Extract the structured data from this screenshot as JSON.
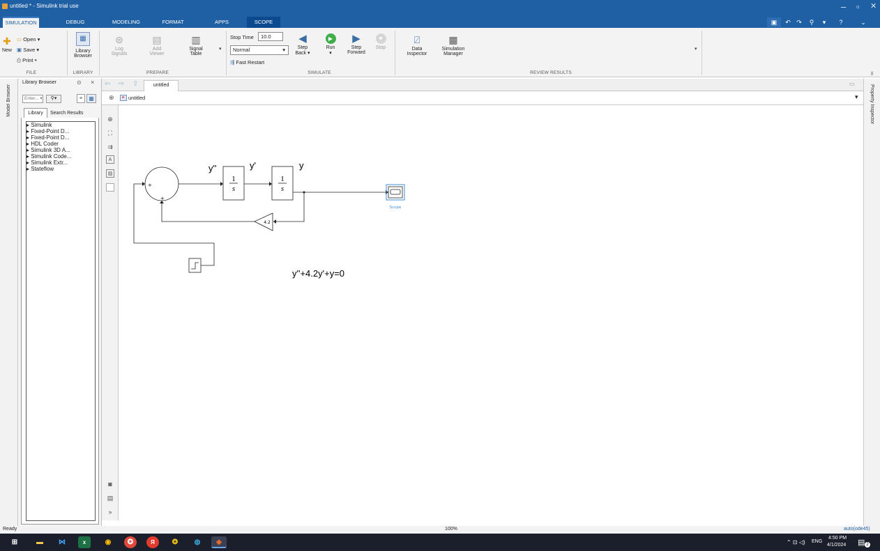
{
  "window": {
    "title": "untitled * - Simulink trial use",
    "minimize": "–",
    "maximize": "▫",
    "close": "✕"
  },
  "tabs": [
    "SIMULATION",
    "DEBUG",
    "MODELING",
    "FORMAT",
    "APPS",
    "SCOPE"
  ],
  "ribbon": {
    "file": {
      "new": "New",
      "open": "Open",
      "save": "Save",
      "print": "Print",
      "label": "FILE"
    },
    "library": {
      "browser_line1": "Library",
      "browser_line2": "Browser",
      "label": "LIBRARY"
    },
    "prepare": {
      "log_line1": "Log",
      "log_line2": "Signals",
      "add_line1": "Add",
      "add_line2": "Viewer",
      "signal_line1": "Signal",
      "signal_line2": "Table",
      "label": "PREPARE"
    },
    "simulate": {
      "stop_time_label": "Stop Time",
      "stop_time_value": "10.0",
      "mode": "Normal",
      "fast_restart": "Fast Restart",
      "step_back_line1": "Step",
      "step_back_line2": "Back",
      "run": "Run",
      "step_fwd_line1": "Step",
      "step_fwd_line2": "Forward",
      "stop": "Stop",
      "label": "SIMULATE"
    },
    "review": {
      "data_line1": "Data",
      "data_line2": "Inspector",
      "sim_line1": "Simulation",
      "sim_line2": "Manager",
      "label": "REVIEW RESULTS"
    }
  },
  "model_browser_label": "Model Browser",
  "property_inspector_label": "Property Inspector",
  "library_browser": {
    "title": "Library Browser",
    "search_placeholder": "Enter...",
    "tabs": [
      "Library",
      "Search Results"
    ],
    "items": [
      "Simulink",
      "Fixed-Point D...",
      "Fixed-Point D...",
      "HDL Coder",
      "Simulink 3D A...",
      "Simulink Code...",
      "Simulink Extr...",
      "Stateflow"
    ]
  },
  "editor": {
    "tab": "untitled",
    "breadcrumb": "untitled"
  },
  "diagram": {
    "signal_labels": [
      "y''",
      "y'",
      "y"
    ],
    "integrator_num": "1",
    "integrator_den": "s",
    "gain": "4.2",
    "sum_signs": [
      "+",
      "+"
    ],
    "scope_label": "Scope",
    "equation": "y''+4.2y'+y=0"
  },
  "status": {
    "left": "Ready",
    "zoom": "100%",
    "solver": "auto(ode45)"
  },
  "taskbar": {
    "time": "4:50 PM",
    "date": "4/1/2024",
    "lang": "ENG",
    "notif_count": "2"
  },
  "colors": {
    "titlebar": "#1f5fa3",
    "scope_tab": "#0c4a8f",
    "taskbar": "#1b1f2b",
    "selection": "#3d8fd6"
  }
}
